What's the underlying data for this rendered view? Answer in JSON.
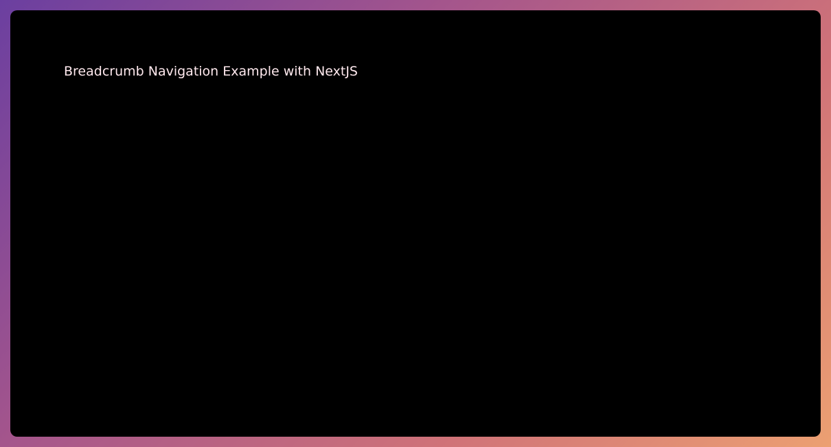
{
  "page": {
    "title": "Breadcrumb Navigation Example with NextJS"
  },
  "colors": {
    "frame_background": "#000000",
    "title_text": "#ffe9ee",
    "gradient_start": "#6b3fa0",
    "gradient_end": "#eca072"
  }
}
